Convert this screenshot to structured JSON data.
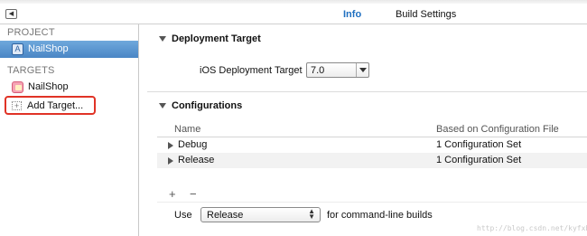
{
  "header": {
    "tabs": [
      {
        "label": "Info",
        "active": true
      },
      {
        "label": "Build Settings",
        "active": false
      }
    ],
    "accent_color": "#1f6fc0"
  },
  "sidebar": {
    "project_heading": "PROJECT",
    "project_item": {
      "label": "NailShop",
      "icon": "xcode-project-icon",
      "selected": true
    },
    "targets_heading": "TARGETS",
    "target_item": {
      "label": "NailShop",
      "icon": "app-target-icon"
    },
    "add_target": {
      "label": "Add Target...",
      "icon": "add-target-icon",
      "highlight_color": "#e03326"
    }
  },
  "deployment": {
    "title": "Deployment Target",
    "ios_label": "iOS Deployment Target",
    "ios_value": "7.0"
  },
  "configurations": {
    "title": "Configurations",
    "columns": {
      "name": "Name",
      "based_on": "Based on Configuration File"
    },
    "rows": [
      {
        "name": "Debug",
        "based_on": "1 Configuration Set"
      },
      {
        "name": "Release",
        "based_on": "1 Configuration Set"
      }
    ],
    "add_symbol": "+",
    "remove_symbol": "−",
    "use_label": "Use",
    "use_value": "Release",
    "use_suffix": "for command-line builds"
  },
  "watermark": "http://blog.csdn.net/kyfxbl"
}
